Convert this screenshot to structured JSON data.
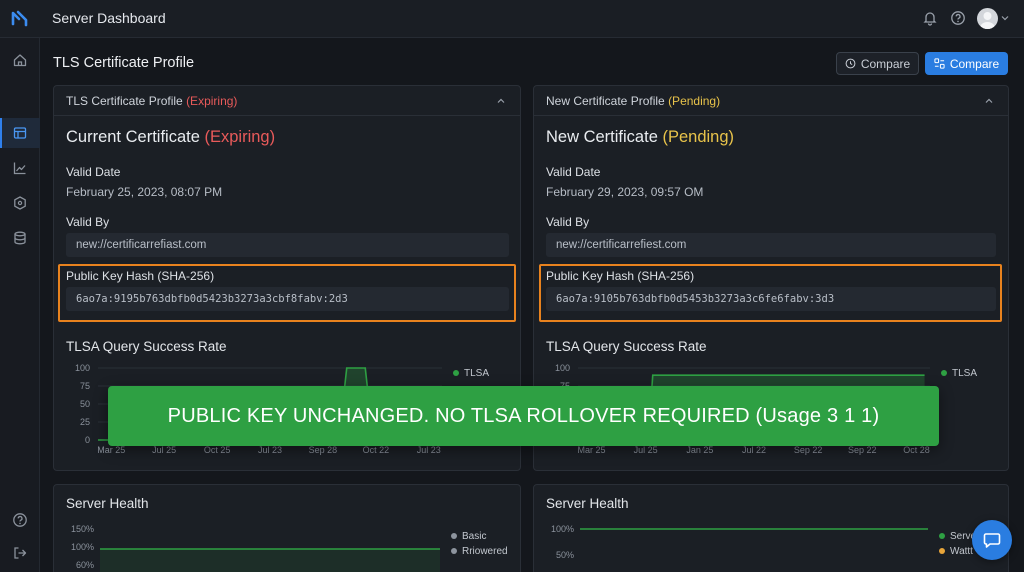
{
  "app": {
    "title": "Server Dashboard"
  },
  "page": {
    "title": "TLS Certificate Profile"
  },
  "toolbar": {
    "compare_outline_label": "Compare",
    "compare_primary_label": "Compare"
  },
  "icons": {
    "logo": "app-logo-icon",
    "top": [
      "bell-icon",
      "help-icon",
      "user-avatar",
      "chevron-down-icon"
    ],
    "sidebar": [
      "home-icon",
      "dashboard-icon",
      "chart-icon",
      "shield-icon",
      "database-icon",
      "help-icon",
      "logout-icon"
    ]
  },
  "colors": {
    "accent": "#2a7de1",
    "expiring": "#e85a5a",
    "pending": "#e8c34a",
    "highlight": "#e8821e",
    "success": "#2ea043",
    "series_green": "#2ea043",
    "series_yellow": "#e8a53a"
  },
  "current": {
    "header_title": "TLS Certificate Profile",
    "header_status": "(Expiring)",
    "heading": "Current Certificate",
    "heading_status": "(Expiring)",
    "valid_date_label": "Valid Date",
    "valid_date": "February 25, 2023, 08:07 PM",
    "valid_by_label": "Valid By",
    "valid_by": "new://certificarrefiast.com",
    "hash_label": "Public Key Hash (SHA-256)",
    "hash_value": "6ao7a:9195b763dbfb0d5423b3273a3cbf8fabv:2d3"
  },
  "new": {
    "header_title": "New Certificate Profile",
    "header_status": "(Pending)",
    "heading": "New Certificate",
    "heading_status": "(Pending)",
    "valid_date_label": "Valid Date",
    "valid_date": "February 29, 2023, 09:57 OM",
    "valid_by_label": "Valid By",
    "valid_by": "new://certificarrefiest.com",
    "hash_label": "Public Key Hash (SHA-256)",
    "hash_value": "6ao7a:9105b763dbfb0d5453b3273a3c6fe6fabv:3d3"
  },
  "banner": {
    "text": "PUBLIC KEY UNCHANGED. NO TLSA ROLLOVER REQUIRED (Usage 3 1 1)"
  },
  "server_health_left": {
    "title": "Server Health"
  },
  "server_health_right": {
    "title": "Server Health"
  },
  "chart_data": [
    {
      "type": "area",
      "title": "TLSA Query Success Rate",
      "categories": [
        "Mar 25",
        "Jul 25",
        "Oct 25",
        "Jul 23",
        "Sep 28",
        "Oct 22",
        "Jul 23"
      ],
      "yticks": [
        0,
        25,
        50,
        75,
        100
      ],
      "ylim": [
        0,
        100
      ],
      "x": [
        0,
        0.3,
        4.55,
        4.7,
        5.05,
        5.2,
        6.5
      ],
      "series": [
        {
          "name": "TLSA",
          "values": [
            0,
            0,
            0,
            100,
            100,
            0,
            0
          ]
        }
      ],
      "legend": "top-right"
    },
    {
      "type": "area",
      "title": "TLSA Query Success Rate",
      "categories": [
        "Mar 25",
        "Jul 25",
        "Jan 25",
        "Jul 22",
        "Sep 22",
        "Sep 22",
        "Oct 28"
      ],
      "yticks": [
        0,
        25,
        50,
        75,
        100
      ],
      "ylim": [
        0,
        100
      ],
      "x": [
        0,
        1.3,
        1.38,
        6.4
      ],
      "series": [
        {
          "name": "TLSA",
          "values": [
            0,
            0,
            90,
            90
          ]
        }
      ],
      "legend": "top-right"
    },
    {
      "type": "line",
      "title": "Server Health",
      "yticks": [
        "150%",
        "100%",
        "60%"
      ],
      "ylim": [
        60,
        150
      ],
      "x": [
        0,
        1
      ],
      "series": [
        {
          "name": "Basic",
          "values": [
            100,
            100
          ]
        },
        {
          "name": "Rriowered",
          "values": []
        }
      ],
      "legend": "right"
    },
    {
      "type": "line",
      "title": "Server Health",
      "yticks": [
        "100%",
        "50%"
      ],
      "ylim": [
        50,
        100
      ],
      "x": [
        0,
        1
      ],
      "series": [
        {
          "name": "Serve",
          "values": [
            100,
            100
          ]
        },
        {
          "name": "Wattt",
          "values": []
        }
      ],
      "legend": "right"
    }
  ]
}
